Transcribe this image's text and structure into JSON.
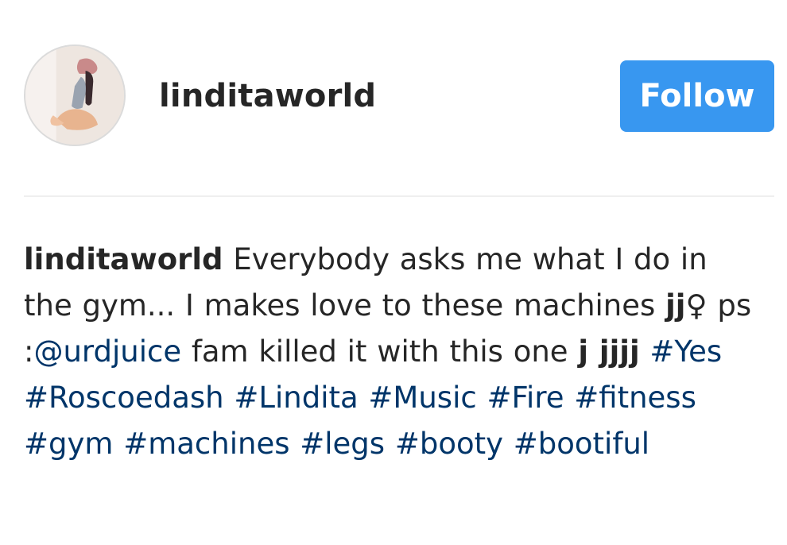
{
  "post": {
    "username": "linditaworld",
    "follow_label": "Follow"
  },
  "caption": {
    "username": "linditaworld",
    "text_1": "Everybody asks me what I do in the gym... I makes love to these machines",
    "emoji_1": "jj",
    "symbol": "♀",
    "text_2": "ps :",
    "mention": "@urdjuice",
    "text_3": "fam killed it with this one",
    "emoji_2": "j jjjj",
    "hashtags": [
      "#Yes",
      "#Roscoedash",
      "#Lindita",
      "#Music",
      "#Fire",
      "#fitness",
      "#gym",
      "#machines",
      "#legs",
      "#booty",
      "#bootiful"
    ]
  },
  "colors": {
    "follow_button": "#3897f0",
    "link": "#003569",
    "text": "#262626"
  }
}
